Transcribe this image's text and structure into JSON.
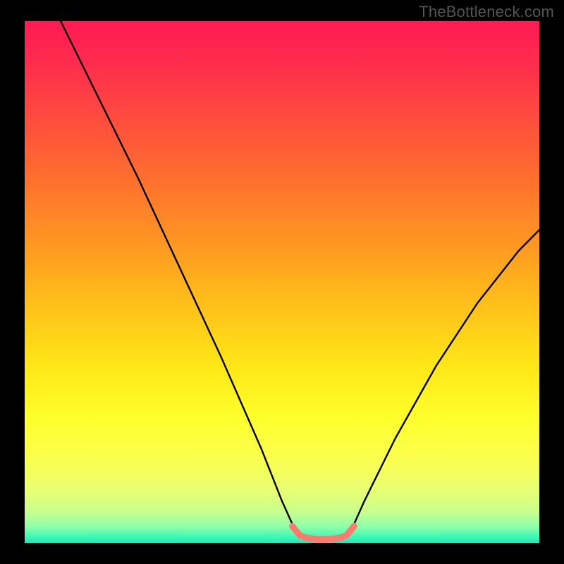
{
  "watermark": "TheBottleneck.com",
  "chart_data": {
    "type": "line",
    "title": "",
    "xlabel": "",
    "ylabel": "",
    "xlim": [
      0,
      100
    ],
    "ylim": [
      0,
      100
    ],
    "annotations": [],
    "series": [
      {
        "name": "main_curve",
        "points": [
          {
            "x": 7,
            "y": 100
          },
          {
            "x": 14,
            "y": 86
          },
          {
            "x": 22,
            "y": 70
          },
          {
            "x": 30,
            "y": 53
          },
          {
            "x": 38,
            "y": 36
          },
          {
            "x": 46,
            "y": 18
          },
          {
            "x": 50,
            "y": 8
          },
          {
            "x": 52.5,
            "y": 2.5
          },
          {
            "x": 54,
            "y": 0.9
          },
          {
            "x": 56,
            "y": 0.5
          },
          {
            "x": 58,
            "y": 0.5
          },
          {
            "x": 60,
            "y": 0.5
          },
          {
            "x": 62,
            "y": 0.9
          },
          {
            "x": 63.5,
            "y": 2.5
          },
          {
            "x": 66,
            "y": 8
          },
          {
            "x": 72,
            "y": 20
          },
          {
            "x": 80,
            "y": 34
          },
          {
            "x": 88,
            "y": 46
          },
          {
            "x": 96,
            "y": 56
          },
          {
            "x": 100,
            "y": 60
          }
        ]
      },
      {
        "name": "highlight_band",
        "color": "#ff7a6e",
        "points": [
          {
            "x": 52,
            "y": 3.2
          },
          {
            "x": 53.5,
            "y": 1.4
          },
          {
            "x": 55,
            "y": 0.9
          },
          {
            "x": 57,
            "y": 0.7
          },
          {
            "x": 59,
            "y": 0.7
          },
          {
            "x": 61,
            "y": 0.9
          },
          {
            "x": 62.5,
            "y": 1.4
          },
          {
            "x": 64,
            "y": 3.2
          }
        ]
      }
    ],
    "gradient_stops": [
      {
        "pos": 0,
        "color": "#ff1a54"
      },
      {
        "pos": 40,
        "color": "#ff8c22"
      },
      {
        "pos": 70,
        "color": "#ffe617"
      },
      {
        "pos": 92,
        "color": "#e8ff73"
      },
      {
        "pos": 100,
        "color": "#18e8c3"
      }
    ]
  }
}
